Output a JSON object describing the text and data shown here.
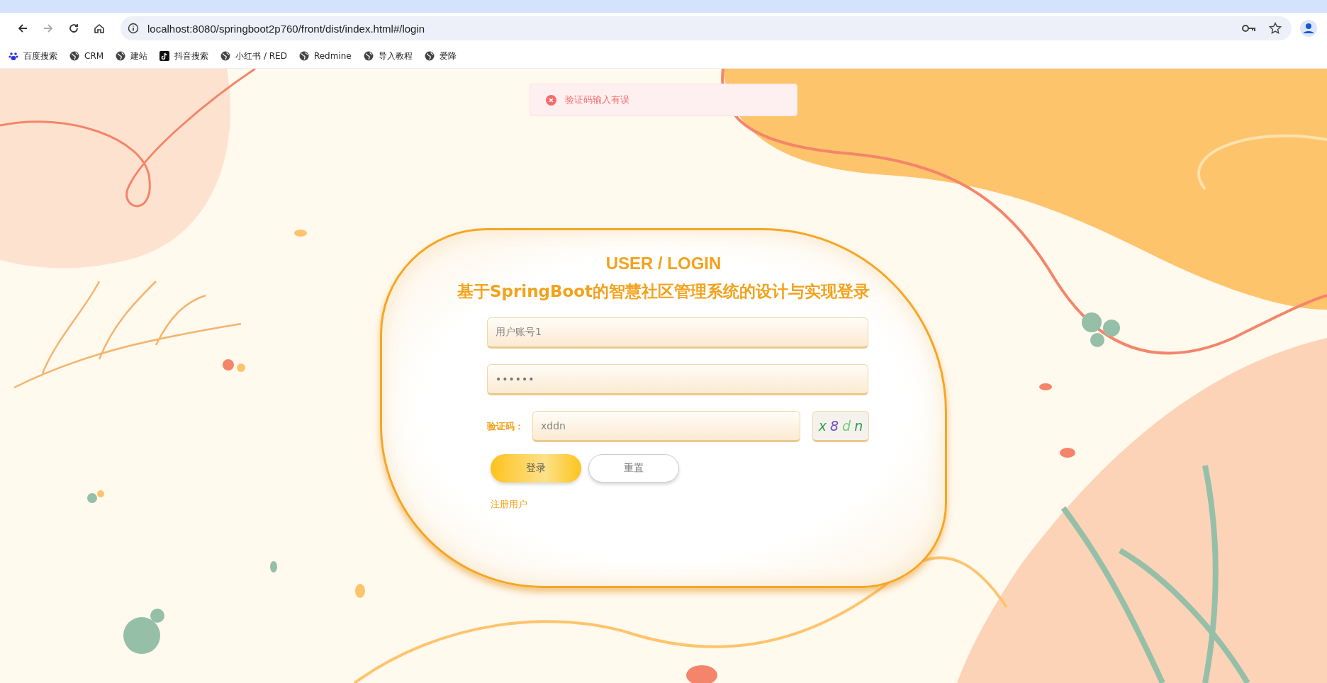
{
  "browser": {
    "address": "localhost:8080/springboot2p760/front/dist/index.html#/login",
    "bookmarks": [
      {
        "kind": "paw",
        "label": "百度搜索"
      },
      {
        "kind": "globe",
        "label": "CRM"
      },
      {
        "kind": "globe",
        "label": "建站"
      },
      {
        "kind": "note",
        "label": "抖音搜索"
      },
      {
        "kind": "globe",
        "label": "小红书 / RED"
      },
      {
        "kind": "globe",
        "label": "Redmine"
      },
      {
        "kind": "globe",
        "label": "导入教程"
      },
      {
        "kind": "globe",
        "label": "爱降"
      }
    ]
  },
  "toast": {
    "kind": "error",
    "message": "验证码输入有误"
  },
  "login": {
    "title": "USER / LOGIN",
    "subtitle": "基于SpringBoot的智慧社区管理系统的设计与实现登录",
    "fields": [
      {
        "kind": "text",
        "value": "用户账号1"
      },
      {
        "kind": "password",
        "value": "••••••"
      }
    ],
    "captcha": {
      "label": "验证码：",
      "value": "xddn",
      "code": [
        {
          "char": "x",
          "color": "#3aa04a"
        },
        {
          "char": "8",
          "color": "#6a4fc0"
        },
        {
          "char": "d",
          "color": "#6ed07a"
        },
        {
          "char": "n",
          "color": "#2f9a48"
        }
      ]
    },
    "buttons": [
      {
        "kind": "primary",
        "label": "登录"
      },
      {
        "kind": "secondary",
        "label": "重置"
      }
    ],
    "register_link": "注册用户"
  }
}
